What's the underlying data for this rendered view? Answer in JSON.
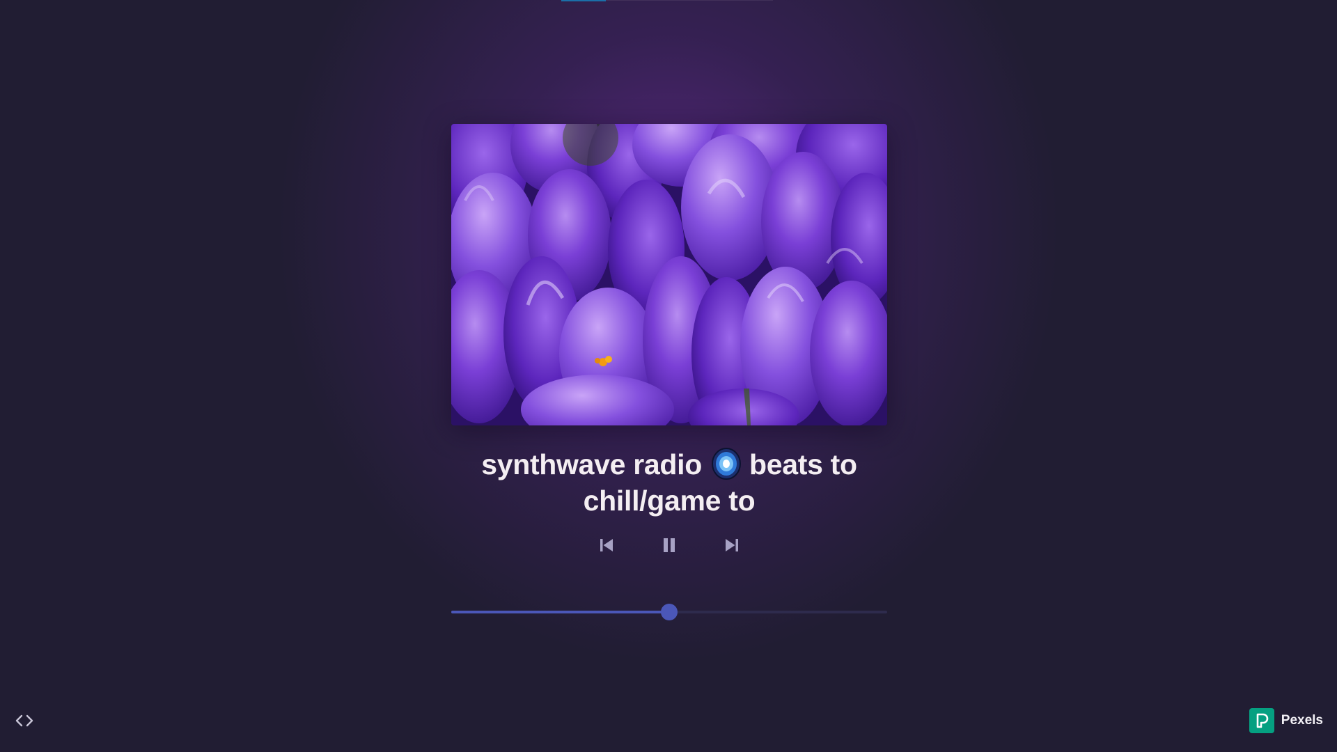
{
  "player": {
    "cover_alt": "Purple crocus flowers",
    "title_part1": "synthwave radio",
    "title_emoji": "galaxy-emoji-icon",
    "title_part2": "beats to chill/game to",
    "controls": {
      "previous": "skip-previous-icon",
      "play_state": "pause-icon",
      "next": "skip-next-icon"
    },
    "progress_fraction": 0.5
  },
  "footer": {
    "code_toggle_icon": "code-brackets-icon",
    "credit_label": "Pexels",
    "credit_icon": "pexels-logo-icon"
  },
  "colors": {
    "background": "#211d33",
    "glow": "#5a2882",
    "accent": "#4b57b8",
    "track": "#2e2b4d",
    "pexels_green": "#05a081",
    "title_text": "#f4eef2"
  }
}
